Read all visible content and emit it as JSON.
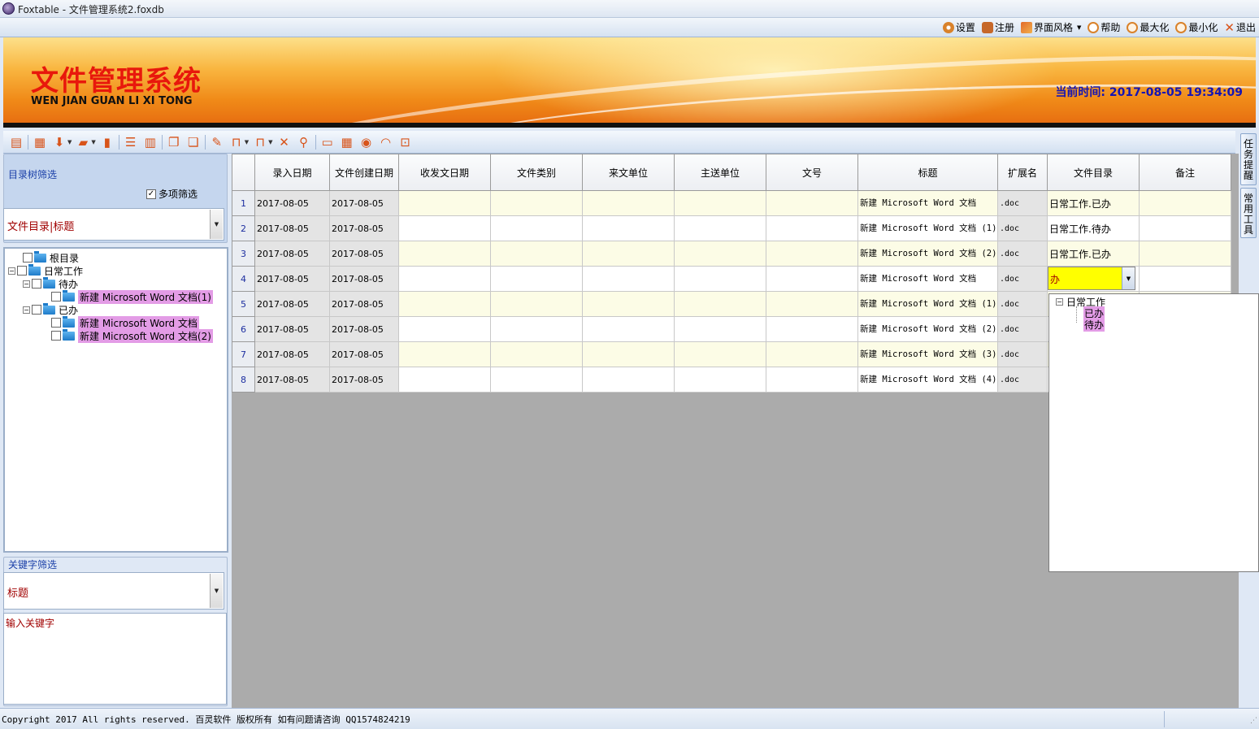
{
  "window": {
    "title": "Foxtable - 文件管理系统2.foxdb"
  },
  "menu": {
    "items": [
      {
        "label": "设置",
        "icon": "gear-icon",
        "color": "#d9822b"
      },
      {
        "label": "注册",
        "icon": "register-icon",
        "color": "#c6682a"
      },
      {
        "label": "界面风格",
        "icon": "palette-icon",
        "color": "#c6682a"
      },
      {
        "label": "帮助",
        "icon": "smiley-help-icon",
        "color": "#d9822b"
      },
      {
        "label": "最大化",
        "icon": "zoom-in-icon",
        "color": "#d9822b"
      },
      {
        "label": "最小化",
        "icon": "zoom-out-icon",
        "color": "#d9822b"
      },
      {
        "label": "退出",
        "icon": "close-icon",
        "color": "#d9822b"
      }
    ]
  },
  "banner": {
    "title": "文件管理系统",
    "subtitle": "WEN JIAN GUAN LI XI TONG",
    "clock_label": "当前时间:",
    "clock_value": "2017-08-05 19:34:09"
  },
  "toolbar": {
    "icons": [
      "save-icon",
      "print-icon",
      "download-icon",
      "open-folder-icon",
      "document-icon",
      "list-icon",
      "table-icon",
      "copy-icon",
      "paste-icon",
      "folder-edit-icon",
      "unlock-icon",
      "lock-icon",
      "delete-icon",
      "search-icon",
      "monitor-icon",
      "calculator-icon",
      "record-icon",
      "rss-icon",
      "zoom-icon"
    ]
  },
  "right_tabs": {
    "task_reminder": "任务提醒",
    "common_tools": "常用工具"
  },
  "left": {
    "tree_filter": {
      "title": "目录树筛选",
      "multi_label": "多项筛选",
      "multi_checked": true,
      "combo_value": "文件目录|标题"
    },
    "tree": {
      "root": "根目录",
      "daily": "日常工作",
      "pending": "待办",
      "pending_file1": "新建 Microsoft Word 文档(1)",
      "done": "已办",
      "done_file1": "新建 Microsoft Word 文档",
      "done_file2": "新建 Microsoft Word 文档(2)"
    },
    "keyword_filter": {
      "title": "关键字筛选",
      "combo_value": "标题",
      "input_placeholder": "输入关键字"
    }
  },
  "grid": {
    "columns": [
      "录入日期",
      "文件创建日期",
      "收发文日期",
      "文件类别",
      "来文单位",
      "主送单位",
      "文号",
      "标题",
      "扩展名",
      "文件目录",
      "备注"
    ],
    "rows": [
      {
        "n": "1",
        "entry": "2017-08-05",
        "created": "2017-08-05",
        "title": "新建 Microsoft Word 文档",
        "ext": ".doc",
        "dir": "日常工作.已办"
      },
      {
        "n": "2",
        "entry": "2017-08-05",
        "created": "2017-08-05",
        "title": "新建 Microsoft Word 文档 (1)",
        "ext": ".doc",
        "dir": "日常工作.待办"
      },
      {
        "n": "3",
        "entry": "2017-08-05",
        "created": "2017-08-05",
        "title": "新建 Microsoft Word 文档 (2)",
        "ext": ".doc",
        "dir": "日常工作.已办"
      },
      {
        "n": "4",
        "entry": "2017-08-05",
        "created": "2017-08-05",
        "title": "新建 Microsoft Word 文档",
        "ext": ".doc",
        "dir": ""
      },
      {
        "n": "5",
        "entry": "2017-08-05",
        "created": "2017-08-05",
        "title": "新建 Microsoft Word 文档 (1)",
        "ext": ".doc",
        "dir": ""
      },
      {
        "n": "6",
        "entry": "2017-08-05",
        "created": "2017-08-05",
        "title": "新建 Microsoft Word 文档 (2)",
        "ext": ".doc",
        "dir": ""
      },
      {
        "n": "7",
        "entry": "2017-08-05",
        "created": "2017-08-05",
        "title": "新建 Microsoft Word 文档 (3)",
        "ext": ".doc",
        "dir": ""
      },
      {
        "n": "8",
        "entry": "2017-08-05",
        "created": "2017-08-05",
        "title": "新建 Microsoft Word 文档 (4)",
        "ext": ".doc",
        "dir": ""
      }
    ],
    "edit_value": "办",
    "dropdown": {
      "parent": "日常工作",
      "child1": "已办",
      "child2": "待办"
    }
  },
  "status": {
    "text": "Copyright 2017 All rights reserved. 百灵软件 版权所有 如有问题请咨询 QQ1574824219"
  },
  "colors": {
    "accent": "#e8180c",
    "clock": "#1414b4",
    "highlight": "#e39ce6",
    "edit": "#ffff00"
  }
}
